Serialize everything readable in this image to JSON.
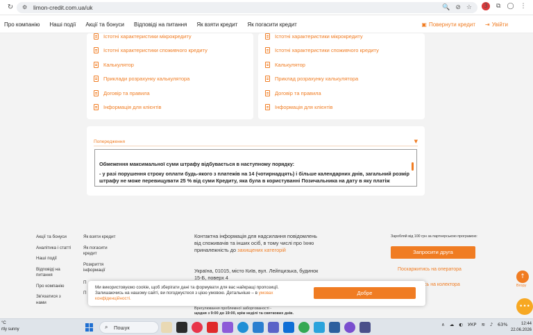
{
  "browser": {
    "url": "limon-credit.com.ua/uk",
    "ext_badge": "3"
  },
  "header": {
    "menu": [
      "Про компанію",
      "Наші події",
      "Акції та бонуси",
      "Відповіді на питання",
      "Як взяти кредит",
      "Як погасити кредит"
    ],
    "return_credit": "Повернути кредит",
    "login": "Увійти"
  },
  "documents": {
    "left": [
      "Істотні характеристики мікрокредиту",
      "Істотні характеристики споживчого кредиту",
      "Калькулятор",
      "Приклади розрахунку калькулятора",
      "Договір та правила",
      "Інформація для клієнтів"
    ],
    "right": [
      "Істотні характеристики мікрокредиту",
      "Істотні характеристики споживчого кредиту",
      "Калькулятор",
      "Приклад розрахунку калькулятора",
      "Договір та правила",
      "Інформація для клієнтів"
    ]
  },
  "warning": {
    "title": "Попередження",
    "heading": "Обмеження максимальної суми штрафу відбувається в наступному порядку:",
    "item": "- у разі порушення строку оплати будь-якого з платежів на 14 (чотирнадцять) і більше календарних днів, загальний розмір штрафу не може перевищувати 25 % від суми Кредиту, яка була в користуванні Позичальника на дату в яку платіж"
  },
  "footer": {
    "col1": [
      "Акції та бонуси",
      "Аналітика і статті",
      "Наші події",
      "Відповіді на питання",
      "Про компанію",
      "Зв'язатися з нами"
    ],
    "col2": [
      "Як взяти кредит",
      "Як погасити кредит",
      "Розкриття інформації",
      "П",
      "П"
    ],
    "contact_text": "Контактна інформація для надсилання повідомлень від споживачів та інших осіб, в тому числі про їхню приналежність до",
    "contact_link": "захищених категорій",
    "address": "Україна, 01015, місто Київ, вул. Лейпцизька, будинок 15-Б, поверх 4",
    "invite_note": "Заробляй від 100 грн за партнерською програмою:",
    "invite_button": "Запросити друга",
    "complain_operator": "Поскаржитись на оператора",
    "complain_collector": "тись на колектора",
    "schedule_title": "Врегулювання проблемної заборгованості -",
    "schedule_hours": "щодня з 9:00 до 19:00, крім неділі та святкових днів."
  },
  "cookie": {
    "text": "Ми використовуємо cookie, щоб зберігати дані та формувати для вас найкращі пропозиції. Залишаючись на нашому сайті, ви погоджуєтеся з цією умовою. Детальніше – в",
    "link": "умовах конфіденційності.",
    "button": "Добре"
  },
  "floating": {
    "up_label": "Вгору"
  },
  "taskbar": {
    "weather_temp": "°C",
    "weather_desc": "rtly sunny",
    "search": "Пошук",
    "lang": "УКР",
    "battery": "63%",
    "time": "12:44",
    "date": "22.06.2026"
  },
  "colors": {
    "accent": "#f07c22",
    "page_bg": "#f3f3f3"
  }
}
